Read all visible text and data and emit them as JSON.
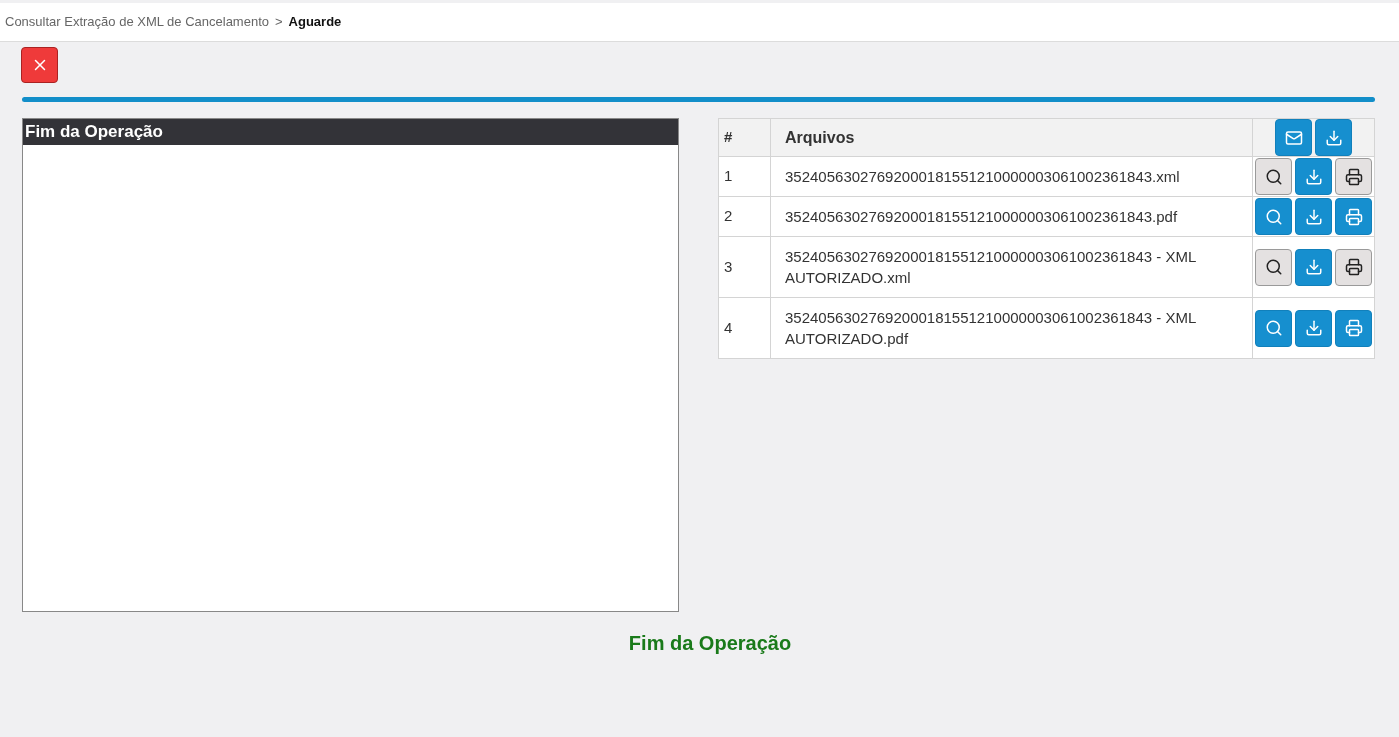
{
  "breadcrumb": {
    "parent": "Consultar Extração de XML de Cancelamento",
    "separator": ">",
    "current": "Aguarde"
  },
  "log_panel": {
    "title": "Fim da Operação"
  },
  "files_table": {
    "columns": [
      "#",
      "Arquivos"
    ],
    "header_actions": [
      {
        "kind": "email",
        "disabled": false
      },
      {
        "kind": "download",
        "disabled": false
      }
    ],
    "rows": [
      {
        "number": "1",
        "file": "35240563027692000181551210000003061002361843.xml",
        "actions": [
          {
            "kind": "view",
            "disabled": true
          },
          {
            "kind": "download",
            "disabled": false
          },
          {
            "kind": "print",
            "disabled": true
          }
        ]
      },
      {
        "number": "2",
        "file": "35240563027692000181551210000003061002361843.pdf",
        "actions": [
          {
            "kind": "view",
            "disabled": false
          },
          {
            "kind": "download",
            "disabled": false
          },
          {
            "kind": "print",
            "disabled": false
          }
        ]
      },
      {
        "number": "3",
        "file": "35240563027692000181551210000003061002361843 - XML AUTORIZADO.xml",
        "actions": [
          {
            "kind": "view",
            "disabled": true
          },
          {
            "kind": "download",
            "disabled": false
          },
          {
            "kind": "print",
            "disabled": true
          }
        ]
      },
      {
        "number": "4",
        "file": "35240563027692000181551210000003061002361843 - XML AUTORIZADO.pdf",
        "actions": [
          {
            "kind": "view",
            "disabled": false
          },
          {
            "kind": "download",
            "disabled": false
          },
          {
            "kind": "print",
            "disabled": false
          }
        ]
      }
    ]
  },
  "status_message": "Fim da Operação"
}
